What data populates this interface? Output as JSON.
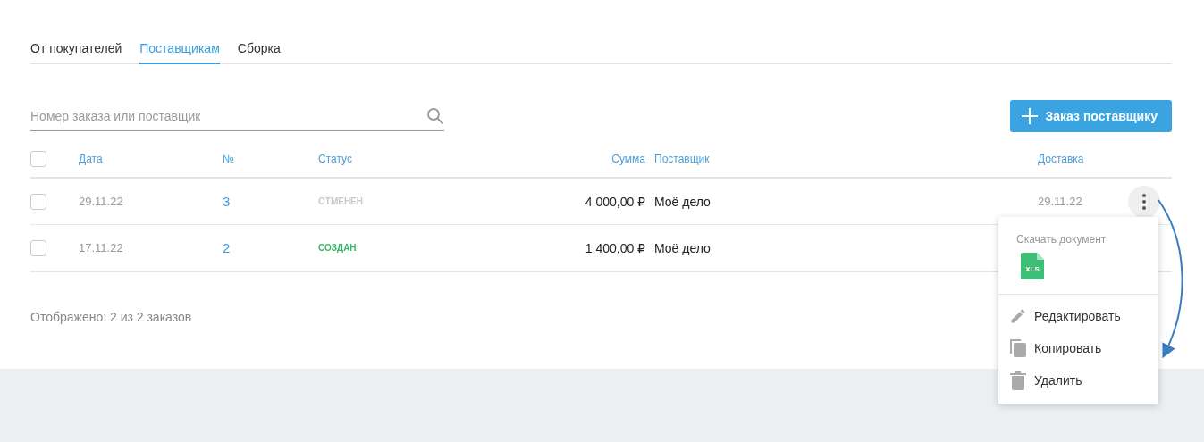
{
  "tabs": [
    {
      "label": "От покупателей",
      "selected": false
    },
    {
      "label": "Поставщикам",
      "selected": true
    },
    {
      "label": "Сборка",
      "selected": false
    }
  ],
  "search": {
    "placeholder": "Номер заказа или поставщик"
  },
  "create_button": "Заказ поставщику",
  "table": {
    "columns": [
      "Дата",
      "№",
      "Статус",
      "Сумма",
      "Поставщик",
      "Доставка"
    ],
    "header_checked": false,
    "rows": [
      {
        "checked": false,
        "date": "29.11.22",
        "number": "3",
        "status": "ОТМЕНЕН",
        "color": "#c9c9c9",
        "sum": "4 000,00 ₽",
        "supplier": "Моё дело",
        "delivery": "29.11.22",
        "menu_open": true
      },
      {
        "checked": false,
        "date": "17.11.22",
        "number": "2",
        "status": "СОЗДАН",
        "color": "#35b86a",
        "sum": "1 400,00 ₽",
        "supplier": "Моё дело",
        "menu_open": false
      }
    ]
  },
  "footer": {
    "shown": "Отображено: 2 из 2 заказов"
  },
  "menu": {
    "section_title": "Скачать документ",
    "file_label": "XLS",
    "items": [
      {
        "label": "Редактировать",
        "kind": "edit"
      },
      {
        "label": "Копировать",
        "kind": "copy"
      },
      {
        "label": "Удалить",
        "kind": "delete"
      }
    ]
  }
}
